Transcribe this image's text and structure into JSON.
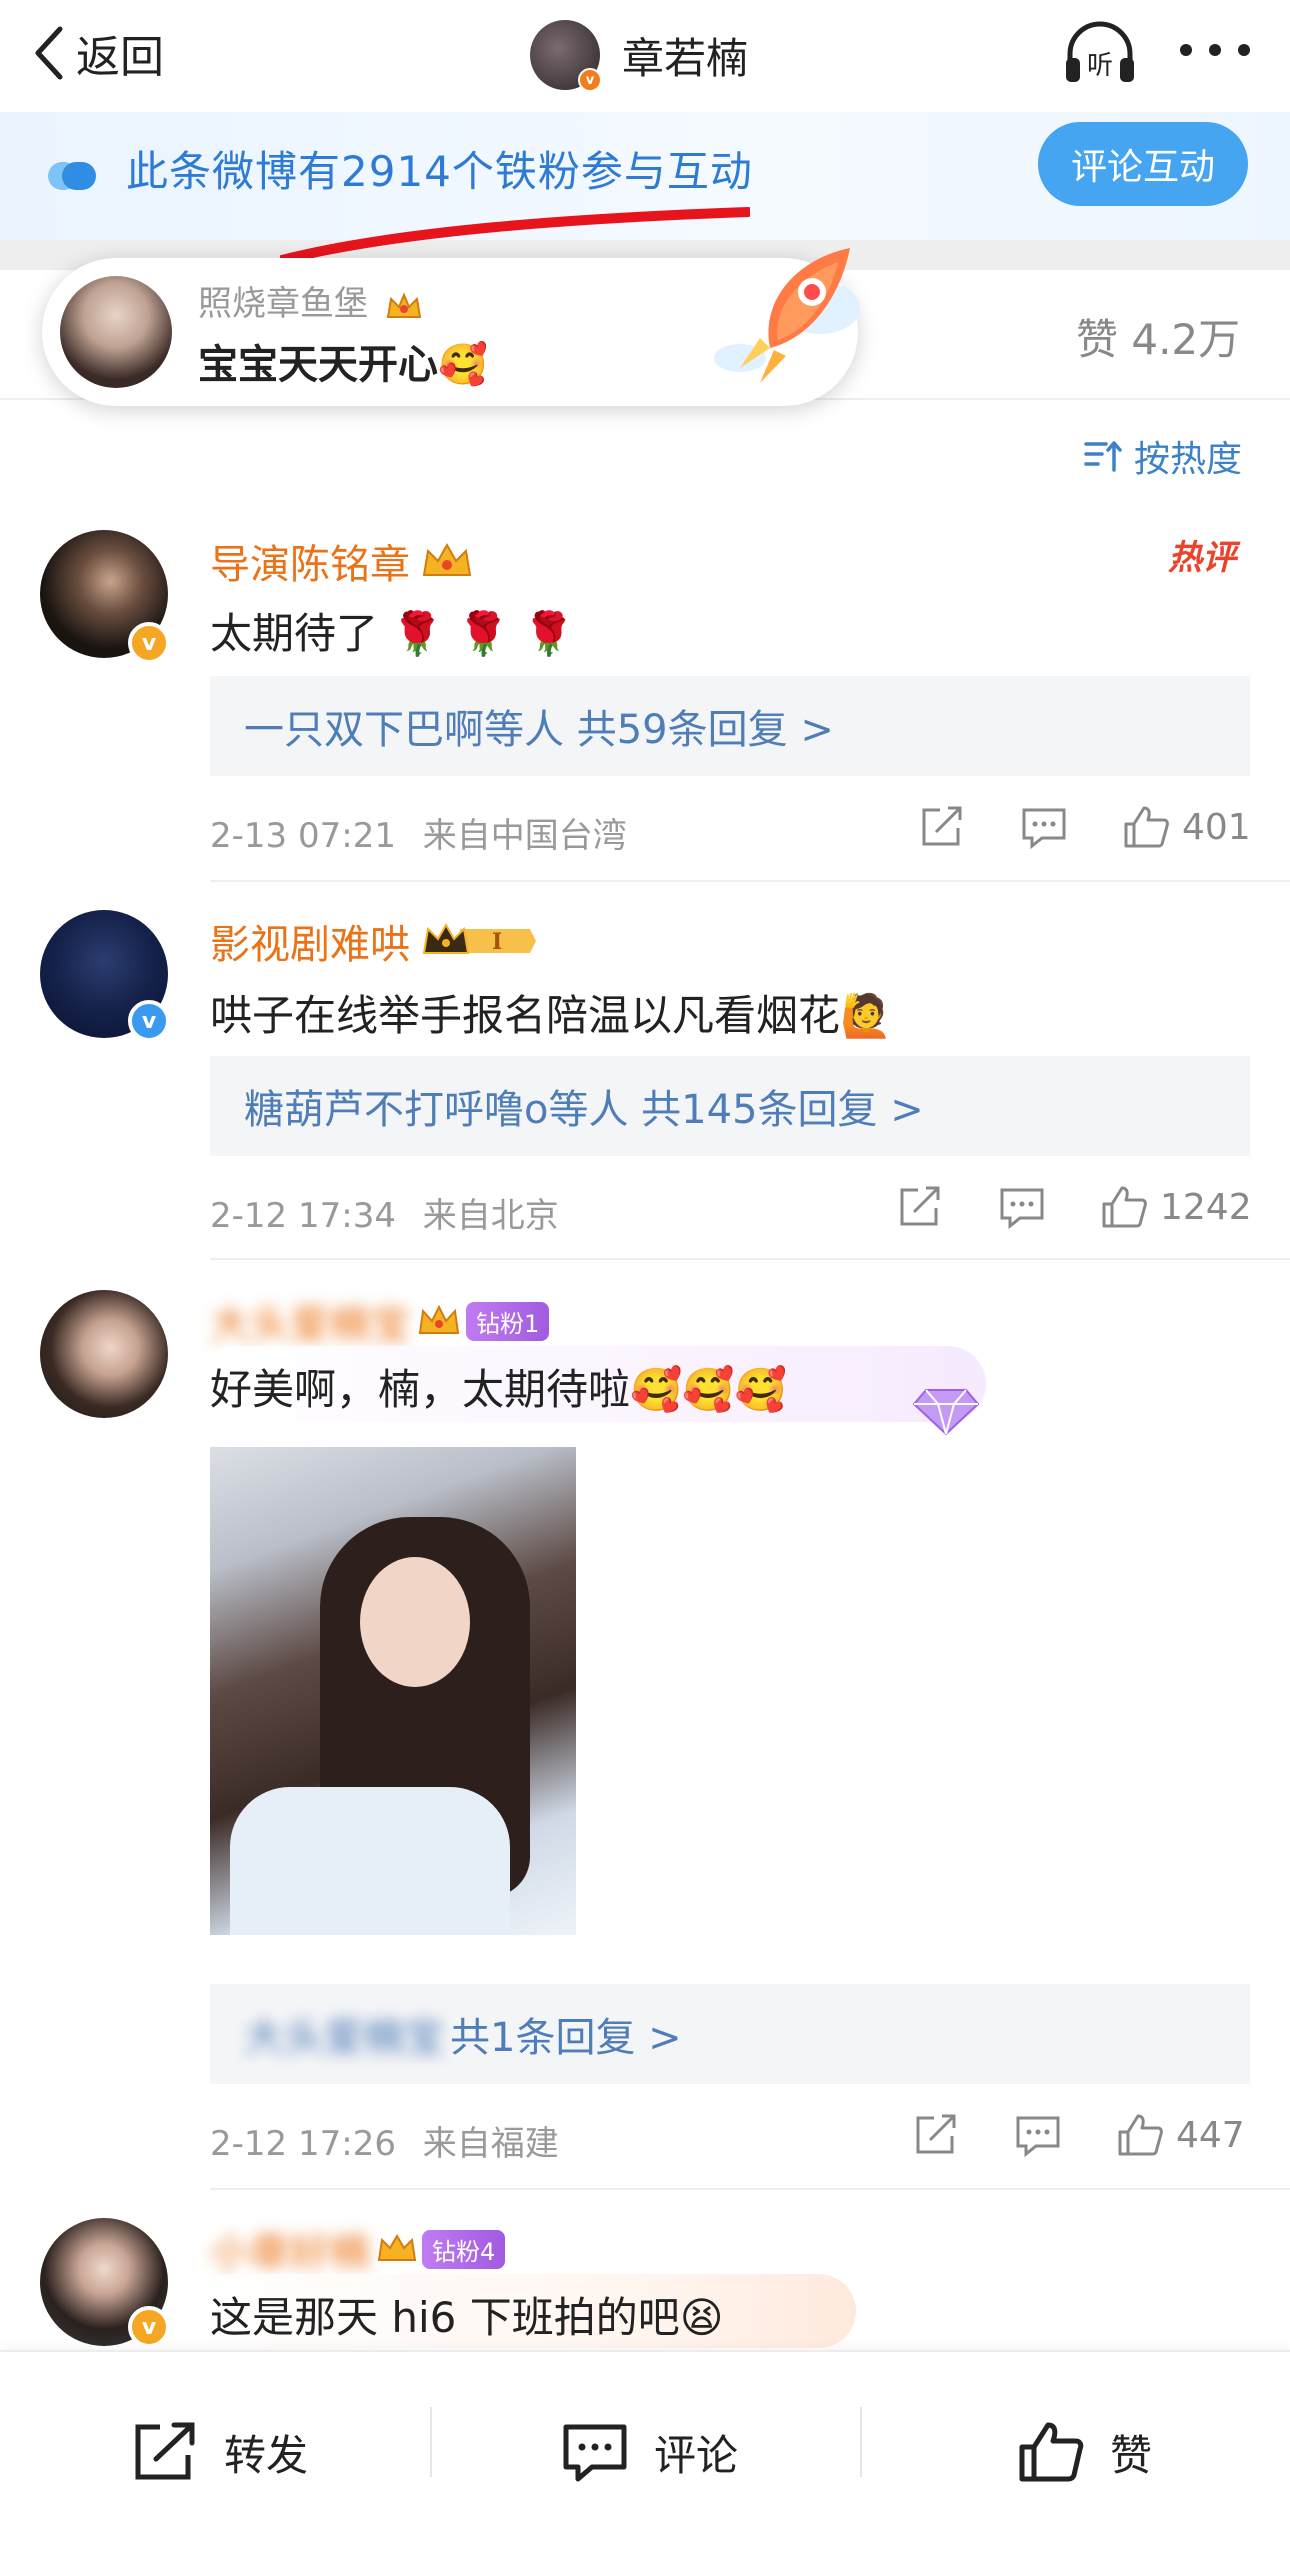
{
  "nav": {
    "back_label": "返回",
    "title": "章若楠",
    "listen_label": "听"
  },
  "banner": {
    "text": "此条微博有2914个铁粉参与互动",
    "button": "评论互动"
  },
  "bubble": {
    "user": "照烧章鱼堡",
    "text": "宝宝天天开心"
  },
  "post_stats": {
    "likes_label": "赞 4.2万"
  },
  "sort": {
    "label": "按热度"
  },
  "comments": [
    {
      "user": "导演陈铭章",
      "hot_tag": "热评",
      "text": "太期待了 🌹 🌹 🌹",
      "replies": "一只双下巴啊等人  共59条回复 >",
      "time": "2-13 07:21",
      "location": "来自中国台湾",
      "likes": "401"
    },
    {
      "user": "影视剧难哄",
      "text": "哄子在线举手报名陪温以凡看烟花🙋",
      "replies": "糖葫芦不打呼噜o等人  共145条回复 >",
      "time": "2-12 17:34",
      "location": "来自北京",
      "likes": "1242"
    },
    {
      "user": "大头爱楠宝",
      "fan_badge": "钻粉1",
      "text": "好美啊，楠，太期待啦🥰🥰🥰",
      "replies_user": "大头爱楠宝",
      "replies_count": "共1条回复 >",
      "time": "2-12 17:26",
      "location": "来自福建",
      "likes": "447"
    },
    {
      "user": "小章好楠",
      "fan_badge": "钻粉4",
      "text": "这是那天 hi6 下班拍的吧😫"
    }
  ],
  "bottom_bar": {
    "repost": "转发",
    "comment": "评论",
    "like": "赞"
  },
  "colors": {
    "accent_blue": "#45a5f0",
    "username_orange": "#eb7317",
    "link_blue": "#4f7db8",
    "hot_red": "#e8442e"
  }
}
